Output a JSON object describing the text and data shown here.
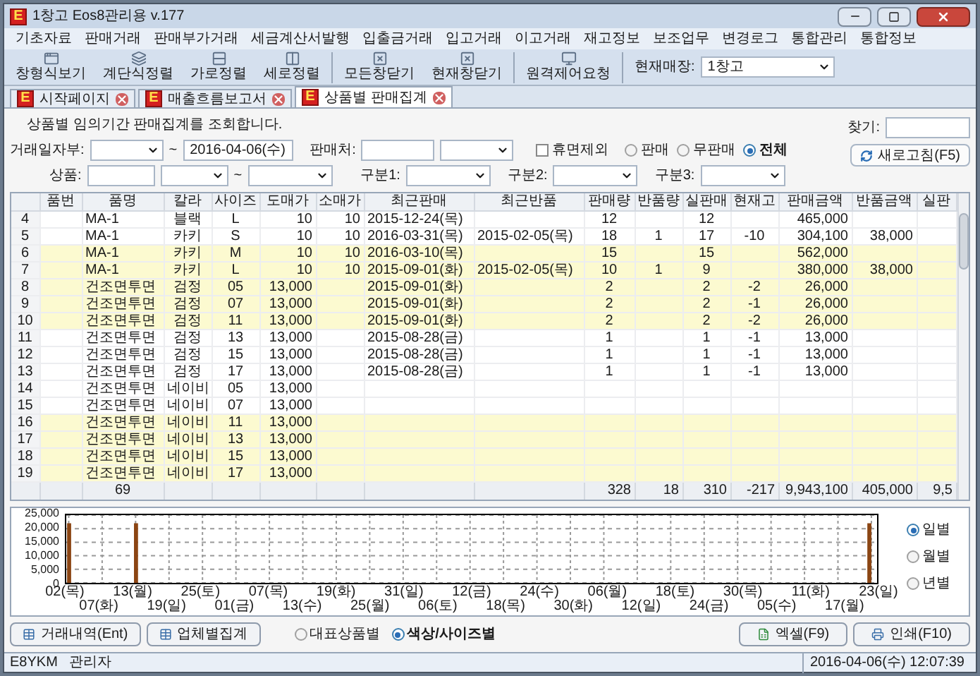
{
  "window": {
    "icon_letter": "E",
    "title": "1창고 Eos8관리용 v.177"
  },
  "menu": [
    "기초자료",
    "판매거래",
    "판매부가거래",
    "세금계산서발행",
    "입출금거래",
    "입고거래",
    "이고거래",
    "재고정보",
    "보조업무",
    "변경로그",
    "통합관리",
    "통합정보"
  ],
  "toolbar": {
    "groups": [
      [
        "창형식보기",
        "계단식정렬",
        "가로정렬",
        "세로정렬"
      ],
      [
        "모든창닫기",
        "현재창닫기"
      ],
      [
        "원격제어요청"
      ]
    ],
    "store_label": "현재매장:",
    "store_value": "1창고"
  },
  "tabs": [
    {
      "icon_letter": "E",
      "label": "시작페이지",
      "selected": false
    },
    {
      "icon_letter": "E",
      "label": "매출흐름보고서",
      "selected": false
    },
    {
      "icon_letter": "E",
      "label": "상품별 판매집계",
      "selected": true
    }
  ],
  "filter": {
    "description": "상품별 임의기간 판매집계를 조회합니다.",
    "date_label": "거래일자부:",
    "date_to": "2016-04-06(수)",
    "tilde": "~",
    "vendor_label": "판매처:",
    "exclude_dormant": {
      "label": "휴면제외",
      "checked": false
    },
    "sale_filter": [
      {
        "label": "판매",
        "selected": false
      },
      {
        "label": "무판매",
        "selected": false
      },
      {
        "label": "전체",
        "selected": true
      }
    ],
    "find_label": "찾기:",
    "refresh_button": "새로고침(F5)",
    "product_label": "상품:",
    "category1_label": "구분1:",
    "category2_label": "구분2:",
    "category3_label": "구분3:"
  },
  "table": {
    "columns": [
      {
        "label": "품번",
        "kind": "text"
      },
      {
        "label": "품명",
        "kind": "text"
      },
      {
        "label": "칼라",
        "kind": "center"
      },
      {
        "label": "사이즈",
        "kind": "center"
      },
      {
        "label": "도매가",
        "kind": "num"
      },
      {
        "label": "소매가",
        "kind": "num"
      },
      {
        "label": "최근판매",
        "kind": "text"
      },
      {
        "label": "최근반품",
        "kind": "text"
      },
      {
        "label": "판매량",
        "kind": "center"
      },
      {
        "label": "반품량",
        "kind": "center"
      },
      {
        "label": "실판매",
        "kind": "center"
      },
      {
        "label": "현재고",
        "kind": "center"
      },
      {
        "label": "판매금액",
        "kind": "num"
      },
      {
        "label": "반품금액",
        "kind": "num"
      },
      {
        "label": "실판",
        "kind": "num"
      }
    ],
    "rows": [
      {
        "number": "4",
        "highlighted": false,
        "cells": [
          "",
          "MA-1",
          "블랙",
          "L",
          "10",
          "10",
          "2015-12-24(목)",
          "",
          "12",
          "",
          "12",
          "",
          "465,000",
          "",
          ""
        ]
      },
      {
        "number": "5",
        "highlighted": false,
        "cells": [
          "",
          "MA-1",
          "카키",
          "S",
          "10",
          "10",
          "2016-03-31(목)",
          "2015-02-05(목)",
          "18",
          "1",
          "17",
          "-10",
          "304,100",
          "38,000",
          ""
        ]
      },
      {
        "number": "6",
        "highlighted": true,
        "cells": [
          "",
          "MA-1",
          "카키",
          "M",
          "10",
          "10",
          "2016-03-10(목)",
          "",
          "15",
          "",
          "15",
          "",
          "562,000",
          "",
          ""
        ]
      },
      {
        "number": "7",
        "highlighted": true,
        "cells": [
          "",
          "MA-1",
          "카키",
          "L",
          "10",
          "10",
          "2015-09-01(화)",
          "2015-02-05(목)",
          "10",
          "1",
          "9",
          "",
          "380,000",
          "38,000",
          ""
        ]
      },
      {
        "number": "8",
        "highlighted": true,
        "cells": [
          "",
          "건조면투면",
          "검정",
          "05",
          "13,000",
          "",
          "2015-09-01(화)",
          "",
          "2",
          "",
          "2",
          "-2",
          "26,000",
          "",
          ""
        ]
      },
      {
        "number": "9",
        "highlighted": true,
        "cells": [
          "",
          "건조면투면",
          "검정",
          "07",
          "13,000",
          "",
          "2015-09-01(화)",
          "",
          "2",
          "",
          "2",
          "-1",
          "26,000",
          "",
          ""
        ]
      },
      {
        "number": "10",
        "highlighted": true,
        "cells": [
          "",
          "건조면투면",
          "검정",
          "11",
          "13,000",
          "",
          "2015-09-01(화)",
          "",
          "2",
          "",
          "2",
          "-2",
          "26,000",
          "",
          ""
        ]
      },
      {
        "number": "11",
        "highlighted": false,
        "cells": [
          "",
          "건조면투면",
          "검정",
          "13",
          "13,000",
          "",
          "2015-08-28(금)",
          "",
          "1",
          "",
          "1",
          "-1",
          "13,000",
          "",
          ""
        ]
      },
      {
        "number": "12",
        "highlighted": false,
        "cells": [
          "",
          "건조면투면",
          "검정",
          "15",
          "13,000",
          "",
          "2015-08-28(금)",
          "",
          "1",
          "",
          "1",
          "-1",
          "13,000",
          "",
          ""
        ]
      },
      {
        "number": "13",
        "highlighted": false,
        "cells": [
          "",
          "건조면투면",
          "검정",
          "17",
          "13,000",
          "",
          "2015-08-28(금)",
          "",
          "1",
          "",
          "1",
          "-1",
          "13,000",
          "",
          ""
        ]
      },
      {
        "number": "14",
        "highlighted": false,
        "cells": [
          "",
          "건조면투면",
          "네이비",
          "05",
          "13,000",
          "",
          "",
          "",
          "",
          "",
          "",
          "",
          "",
          "",
          ""
        ]
      },
      {
        "number": "15",
        "highlighted": false,
        "cells": [
          "",
          "건조면투면",
          "네이비",
          "07",
          "13,000",
          "",
          "",
          "",
          "",
          "",
          "",
          "",
          "",
          "",
          ""
        ]
      },
      {
        "number": "16",
        "highlighted": true,
        "cells": [
          "",
          "건조면투면",
          "네이비",
          "11",
          "13,000",
          "",
          "",
          "",
          "",
          "",
          "",
          "",
          "",
          "",
          ""
        ]
      },
      {
        "number": "17",
        "highlighted": true,
        "cells": [
          "",
          "건조면투면",
          "네이비",
          "13",
          "13,000",
          "",
          "",
          "",
          "",
          "",
          "",
          "",
          "",
          "",
          ""
        ]
      },
      {
        "number": "18",
        "highlighted": true,
        "cells": [
          "",
          "건조면투면",
          "네이비",
          "15",
          "13,000",
          "",
          "",
          "",
          "",
          "",
          "",
          "",
          "",
          "",
          ""
        ]
      },
      {
        "number": "19",
        "highlighted": true,
        "cells": [
          "",
          "건조면투면",
          "네이비",
          "17",
          "13,000",
          "",
          "",
          "",
          "",
          "",
          "",
          "",
          "",
          "",
          ""
        ]
      }
    ],
    "totals": {
      "cells": [
        "",
        "69",
        "",
        "",
        "",
        "",
        "",
        "",
        "328",
        "18",
        "310",
        "-217",
        "9,943,100",
        "405,000",
        "9,5"
      ]
    }
  },
  "chart": {
    "chart_data": {
      "type": "bar",
      "categories": [
        "02(목)",
        "07(화)",
        "13(월)",
        "19(일)",
        "25(토)",
        "01(금)",
        "07(목)",
        "13(수)",
        "19(화)",
        "25(월)",
        "31(일)",
        "06(토)",
        "12(금)",
        "18(목)",
        "24(수)",
        "30(화)",
        "06(월)",
        "12(일)",
        "18(토)",
        "24(금)",
        "30(목)",
        "05(수)",
        "11(화)",
        "17(월)",
        "23(일)"
      ],
      "grid": true,
      "series": [
        {
          "color": "#8b4513",
          "values": [
            22000,
            null,
            22000,
            null,
            null,
            null,
            null,
            null,
            null,
            null,
            null,
            null,
            null,
            null,
            null,
            null,
            null,
            null,
            null,
            null,
            null,
            null,
            null,
            null,
            22000
          ]
        }
      ],
      "ylim": [
        0,
        25000
      ],
      "yticks": [
        {
          "value": 0,
          "label": "0"
        },
        {
          "value": 5000,
          "label": "5,000"
        },
        {
          "value": 10000,
          "label": "10,000"
        },
        {
          "value": 15000,
          "label": "15,000"
        },
        {
          "value": 20000,
          "label": "20,000"
        },
        {
          "value": 25000,
          "label": "25,000"
        }
      ]
    },
    "period": [
      {
        "label": "일별",
        "selected": true
      },
      {
        "label": "월별",
        "selected": false
      },
      {
        "label": "년별",
        "selected": false
      }
    ]
  },
  "bottom": {
    "left_buttons": [
      "거래내역(Ent)",
      "업체별집계"
    ],
    "group_by": [
      {
        "label": "대표상품별",
        "selected": false
      },
      {
        "label": "색상/사이즈별",
        "selected": true
      }
    ],
    "right_buttons": [
      "엑셀(F9)",
      "인쇄(F10)"
    ]
  },
  "status_bar": {
    "user_code": "E8YKM",
    "role": "관리자",
    "datetime": "2016-04-06(수) 12:07:39"
  }
}
